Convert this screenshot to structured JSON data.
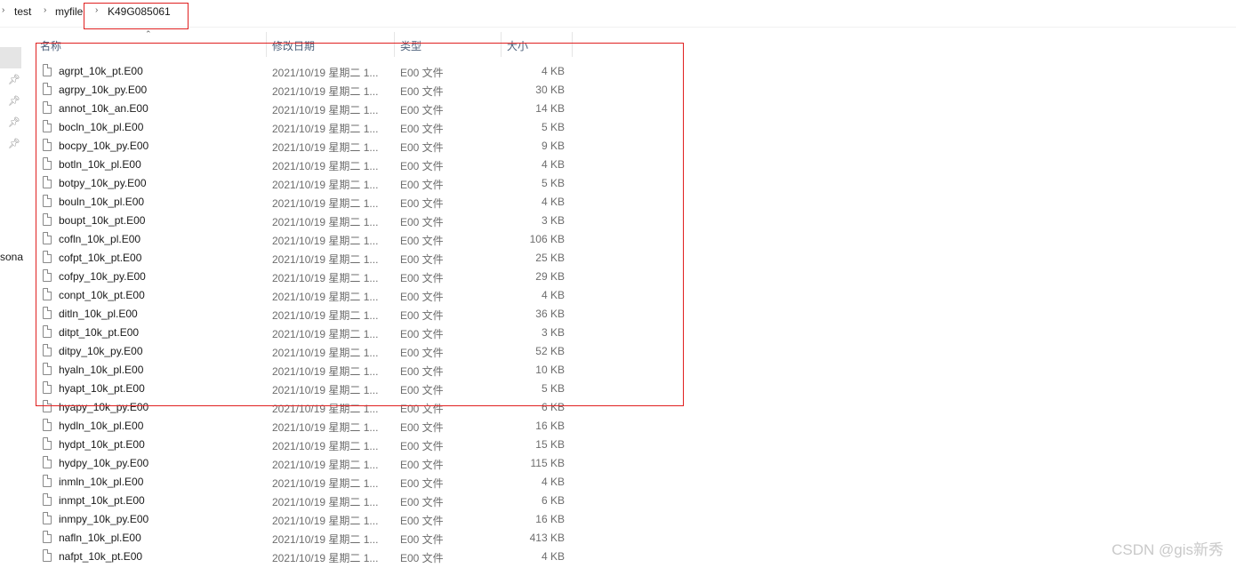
{
  "breadcrumb": {
    "items": [
      "test",
      "myfile",
      "K49G085061"
    ]
  },
  "nav": {
    "partial_label": "sona"
  },
  "columns": {
    "name": "名称",
    "date": "修改日期",
    "type": "类型",
    "size": "大小"
  },
  "files": [
    {
      "name": "agrpt_10k_pt.E00",
      "date": "2021/10/19 星期二 1...",
      "type": "E00 文件",
      "size": "4 KB"
    },
    {
      "name": "agrpy_10k_py.E00",
      "date": "2021/10/19 星期二 1...",
      "type": "E00 文件",
      "size": "30 KB"
    },
    {
      "name": "annot_10k_an.E00",
      "date": "2021/10/19 星期二 1...",
      "type": "E00 文件",
      "size": "14 KB"
    },
    {
      "name": "bocln_10k_pl.E00",
      "date": "2021/10/19 星期二 1...",
      "type": "E00 文件",
      "size": "5 KB"
    },
    {
      "name": "bocpy_10k_py.E00",
      "date": "2021/10/19 星期二 1...",
      "type": "E00 文件",
      "size": "9 KB"
    },
    {
      "name": "botln_10k_pl.E00",
      "date": "2021/10/19 星期二 1...",
      "type": "E00 文件",
      "size": "4 KB"
    },
    {
      "name": "botpy_10k_py.E00",
      "date": "2021/10/19 星期二 1...",
      "type": "E00 文件",
      "size": "5 KB"
    },
    {
      "name": "bouln_10k_pl.E00",
      "date": "2021/10/19 星期二 1...",
      "type": "E00 文件",
      "size": "4 KB"
    },
    {
      "name": "boupt_10k_pt.E00",
      "date": "2021/10/19 星期二 1...",
      "type": "E00 文件",
      "size": "3 KB"
    },
    {
      "name": "cofln_10k_pl.E00",
      "date": "2021/10/19 星期二 1...",
      "type": "E00 文件",
      "size": "106 KB"
    },
    {
      "name": "cofpt_10k_pt.E00",
      "date": "2021/10/19 星期二 1...",
      "type": "E00 文件",
      "size": "25 KB"
    },
    {
      "name": "cofpy_10k_py.E00",
      "date": "2021/10/19 星期二 1...",
      "type": "E00 文件",
      "size": "29 KB"
    },
    {
      "name": "conpt_10k_pt.E00",
      "date": "2021/10/19 星期二 1...",
      "type": "E00 文件",
      "size": "4 KB"
    },
    {
      "name": "ditln_10k_pl.E00",
      "date": "2021/10/19 星期二 1...",
      "type": "E00 文件",
      "size": "36 KB"
    },
    {
      "name": "ditpt_10k_pt.E00",
      "date": "2021/10/19 星期二 1...",
      "type": "E00 文件",
      "size": "3 KB"
    },
    {
      "name": "ditpy_10k_py.E00",
      "date": "2021/10/19 星期二 1...",
      "type": "E00 文件",
      "size": "52 KB"
    },
    {
      "name": "hyaln_10k_pl.E00",
      "date": "2021/10/19 星期二 1...",
      "type": "E00 文件",
      "size": "10 KB"
    },
    {
      "name": "hyapt_10k_pt.E00",
      "date": "2021/10/19 星期二 1...",
      "type": "E00 文件",
      "size": "5 KB"
    },
    {
      "name": "hyapy_10k_py.E00",
      "date": "2021/10/19 星期二 1...",
      "type": "E00 文件",
      "size": "6 KB"
    },
    {
      "name": "hydln_10k_pl.E00",
      "date": "2021/10/19 星期二 1...",
      "type": "E00 文件",
      "size": "16 KB"
    },
    {
      "name": "hydpt_10k_pt.E00",
      "date": "2021/10/19 星期二 1...",
      "type": "E00 文件",
      "size": "15 KB"
    },
    {
      "name": "hydpy_10k_py.E00",
      "date": "2021/10/19 星期二 1...",
      "type": "E00 文件",
      "size": "115 KB"
    },
    {
      "name": "inmln_10k_pl.E00",
      "date": "2021/10/19 星期二 1...",
      "type": "E00 文件",
      "size": "4 KB"
    },
    {
      "name": "inmpt_10k_pt.E00",
      "date": "2021/10/19 星期二 1...",
      "type": "E00 文件",
      "size": "6 KB"
    },
    {
      "name": "inmpy_10k_py.E00",
      "date": "2021/10/19 星期二 1...",
      "type": "E00 文件",
      "size": "16 KB"
    },
    {
      "name": "nafln_10k_pl.E00",
      "date": "2021/10/19 星期二 1...",
      "type": "E00 文件",
      "size": "413 KB"
    },
    {
      "name": "nafpt_10k_pt.E00",
      "date": "2021/10/19 星期二 1...",
      "type": "E00 文件",
      "size": "4 KB"
    }
  ],
  "watermark": "CSDN @gis新秀",
  "colors": {
    "highlight_box": "#e02020",
    "header_text": "#4c607a",
    "detail_text": "#6d6d6d"
  }
}
